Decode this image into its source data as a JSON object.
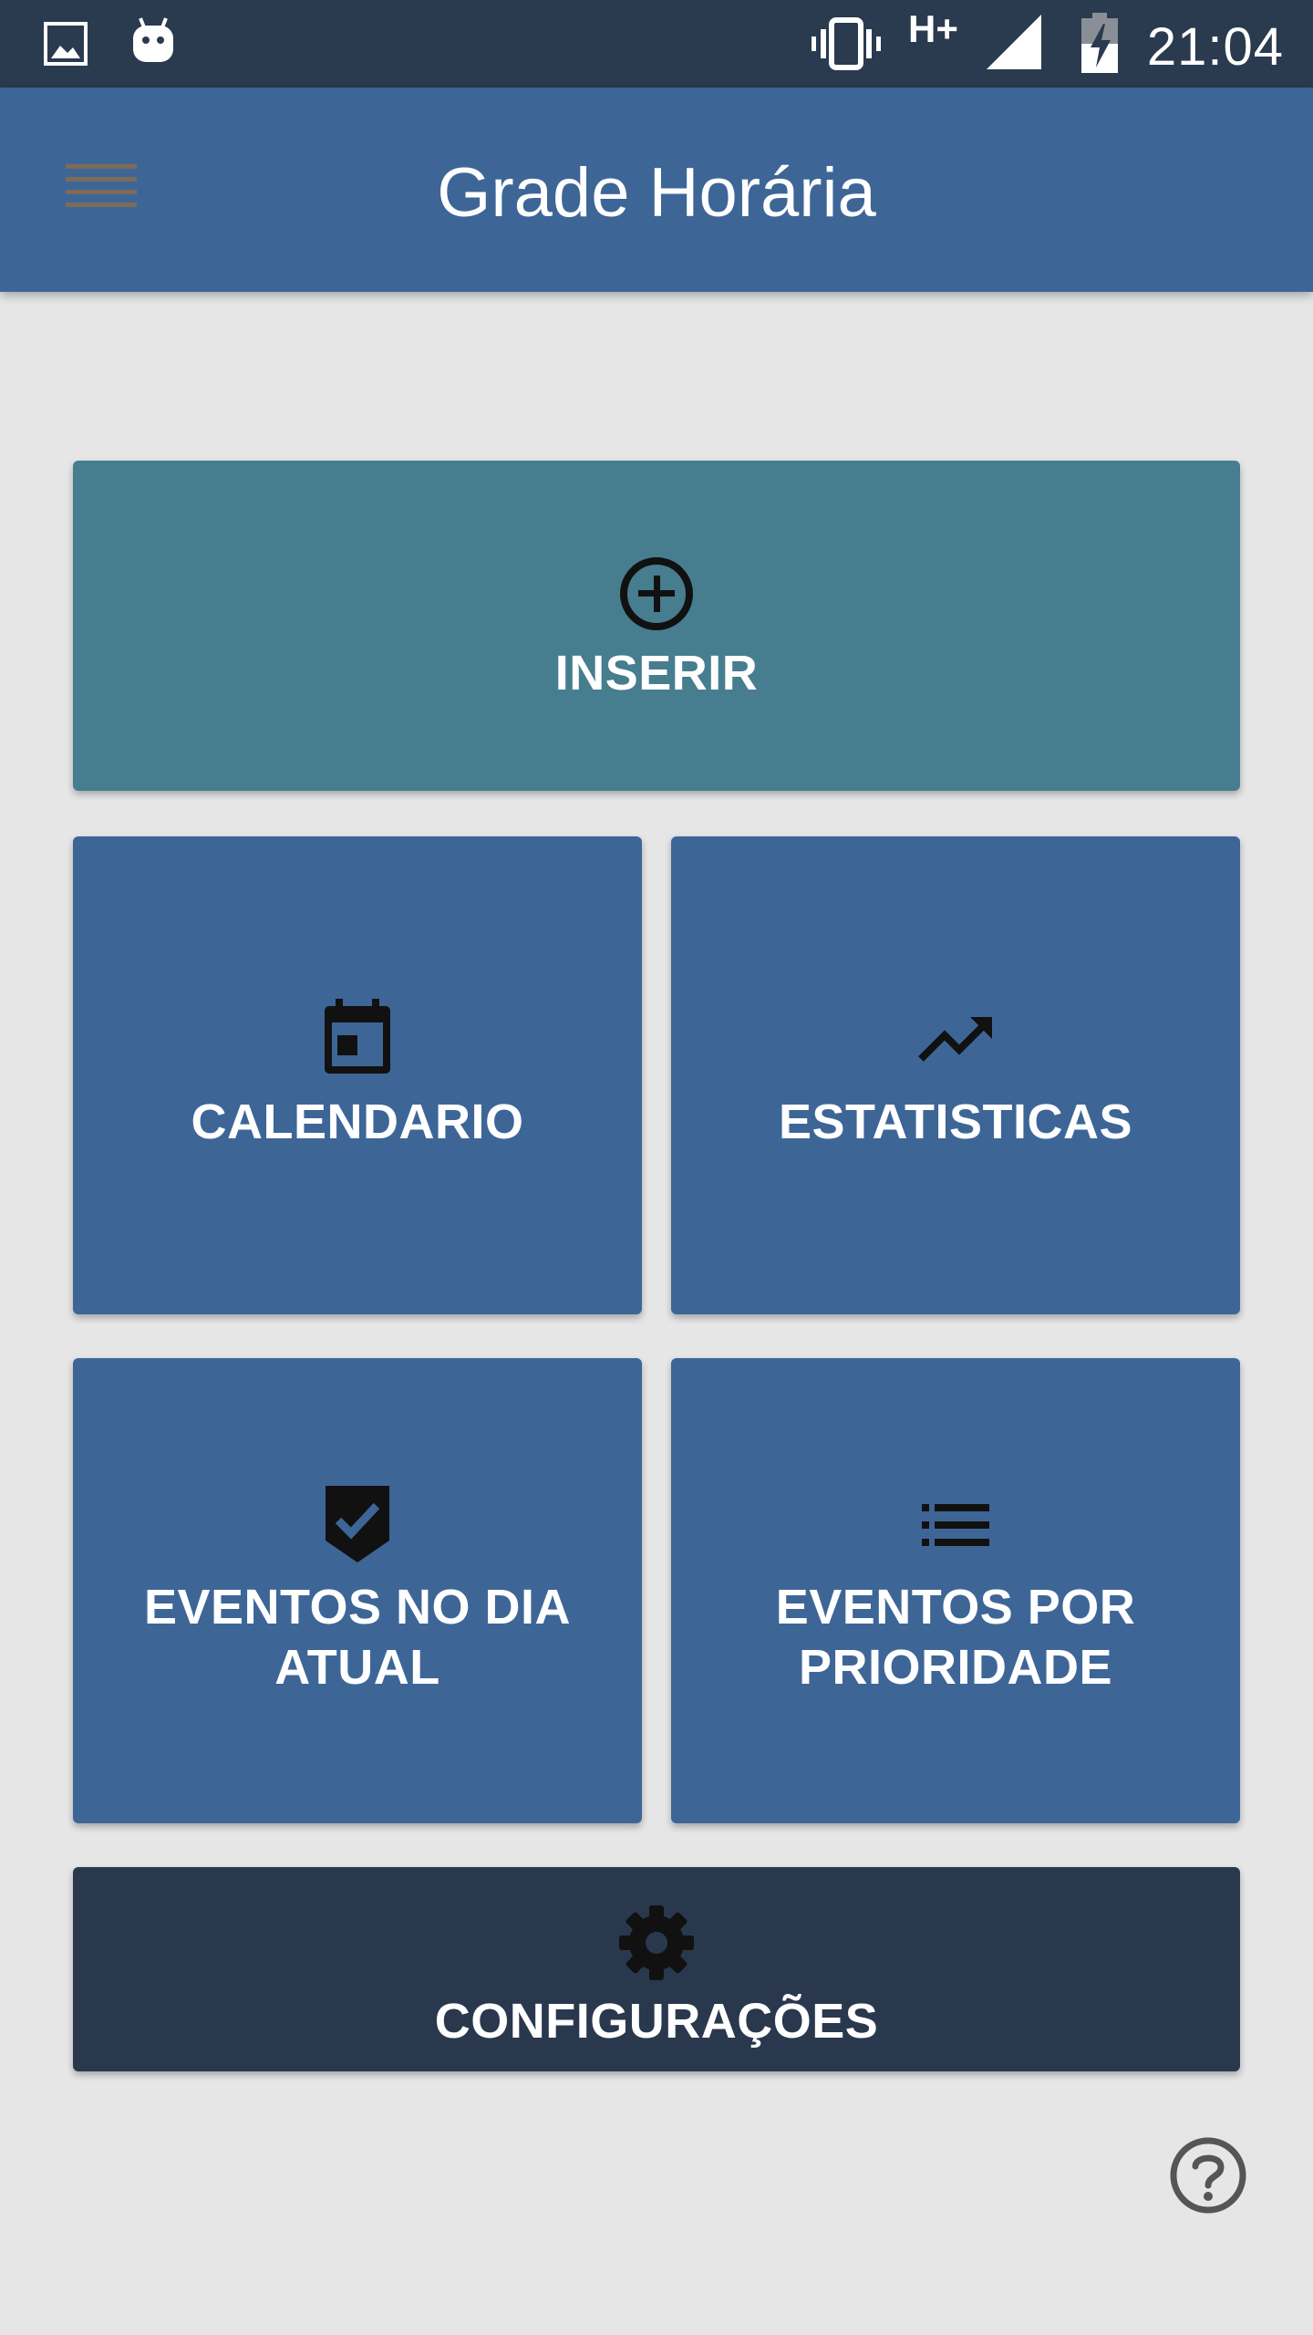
{
  "status_bar": {
    "network": "H+",
    "time": "21:04",
    "icons": [
      "image-icon",
      "android-icon",
      "vibrate-icon",
      "signal-icon",
      "battery-charging-icon"
    ]
  },
  "app_bar": {
    "title": "Grade Horária",
    "menu_icon": "menu-icon"
  },
  "tiles": {
    "inserir": {
      "label": "INSERIR",
      "icon": "add-circle-icon"
    },
    "calendario": {
      "label": "CALENDARIO",
      "icon": "calendar-icon"
    },
    "estatisticas": {
      "label": "ESTATISTICAS",
      "icon": "trending-up-icon"
    },
    "eventos_dia": {
      "label_line1": "EVENTOS NO DIA",
      "label_line2": "ATUAL",
      "icon": "check-badge-icon"
    },
    "eventos_prioridade": {
      "label_line1": "EVENTOS POR",
      "label_line2": "PRIORIDADE",
      "icon": "list-icon"
    },
    "configuracoes": {
      "label": "CONFIGURAÇÕES",
      "icon": "gear-icon"
    }
  },
  "help": {
    "icon": "help-icon"
  },
  "colors": {
    "status_bar": "#2a3a4f",
    "app_bar": "#3d6697",
    "tile_teal": "#467d8f",
    "tile_blue": "#3d6697",
    "tile_dark": "#29384d",
    "background": "#e6e6e7"
  }
}
